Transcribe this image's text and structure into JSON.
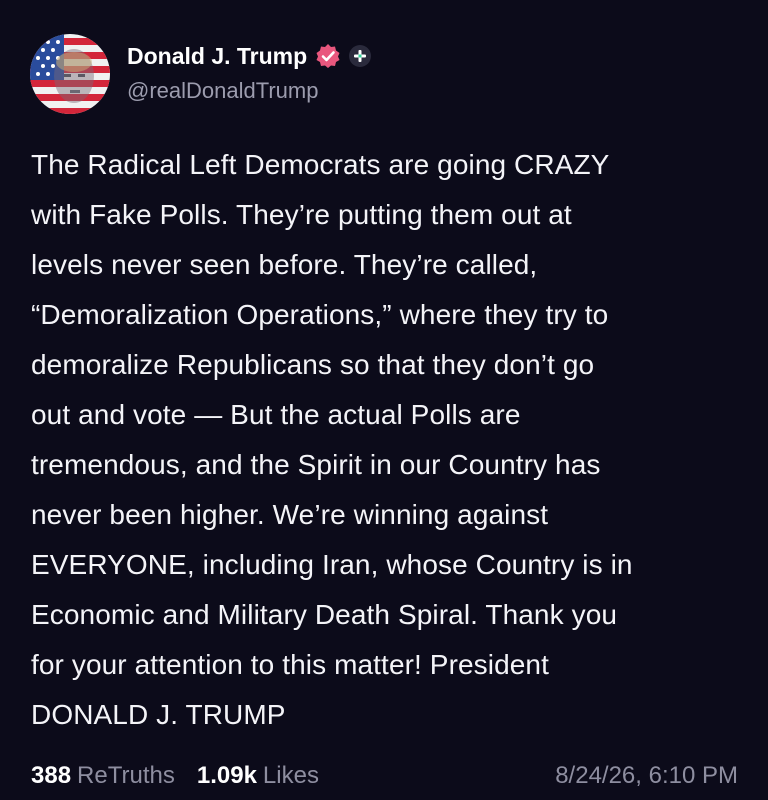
{
  "author": {
    "display_name": "Donald J. Trump",
    "handle": "@realDonaldTrump",
    "verified_icon": "verified-badge-icon",
    "plus_icon": "plus-badge-icon",
    "avatar": "avatar-flag-portrait"
  },
  "post": {
    "text": "The Radical Left Democrats are going CRAZY\nwith Fake Polls. They’re putting them out at\nlevels never seen before. They’re called,\n“Demoralization Operations,” where they try to\ndemoralize Republicans so that they don’t go\nout and vote — But the actual Polls are\ntremendous, and the Spirit in our Country has\nnever been higher. We’re winning against\nEVERYONE, including Iran, whose Country is in\nEconomic and Military Death Spiral. Thank you\nfor your attention to this matter! President\nDONALD J. TRUMP"
  },
  "stats": {
    "retruths_count": "388",
    "retruths_label": "ReTruths",
    "likes_count": "1.09k",
    "likes_label": "Likes",
    "timestamp": "8/24/26, 6:10 PM"
  },
  "colors": {
    "background": "#0c0b1a",
    "verified_pink": "#e9577e",
    "muted_text": "#8e8ea0"
  }
}
